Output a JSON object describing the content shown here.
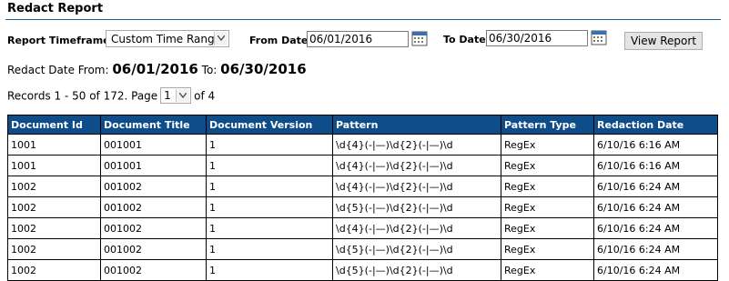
{
  "page": {
    "title": "Redact Report"
  },
  "filters": {
    "timeframe_label": "Report Timeframe",
    "timeframe_value": "Custom Time Range",
    "from_label": "From Date",
    "from_value": "06/01/2016",
    "to_label": "To Date",
    "to_value": "06/30/2016",
    "view_button": "View Report"
  },
  "summary": {
    "prefix": "Redact Date From:",
    "from": "06/01/2016",
    "to_label": "To:",
    "to": "06/30/2016"
  },
  "pager": {
    "records_text": "Records 1 - 50 of 172. Page",
    "page_value": "1",
    "of_text": "of 4"
  },
  "table": {
    "headers": [
      "Document Id",
      "Document Title",
      "Document Version",
      "Pattern",
      "Pattern Type",
      "Redaction Date"
    ],
    "rows": [
      [
        "1001",
        "001001",
        "1",
        "\\d{4}(-|—)\\d{2}(-|—)\\d",
        "RegEx",
        "6/10/16 6:16 AM"
      ],
      [
        "1001",
        "001001",
        "1",
        "\\d{4}(-|—)\\d{2}(-|—)\\d",
        "RegEx",
        "6/10/16 6:16 AM"
      ],
      [
        "1002",
        "001002",
        "1",
        "\\d{4}(-|—)\\d{2}(-|—)\\d",
        "RegEx",
        "6/10/16 6:24 AM"
      ],
      [
        "1002",
        "001002",
        "1",
        "\\d{5}(-|—)\\d{2}(-|—)\\d",
        "RegEx",
        "6/10/16 6:24 AM"
      ],
      [
        "1002",
        "001002",
        "1",
        "\\d{4}(-|—)\\d{2}(-|—)\\d",
        "RegEx",
        "6/10/16 6:24 AM"
      ],
      [
        "1002",
        "001002",
        "1",
        "\\d{5}(-|—)\\d{2}(-|—)\\d",
        "RegEx",
        "6/10/16 6:24 AM"
      ],
      [
        "1002",
        "001002",
        "1",
        "\\d{5}(-|—)\\d{2}(-|—)\\d",
        "RegEx",
        "6/10/16 6:24 AM"
      ]
    ]
  },
  "icons": {
    "calendar": "calendar-icon",
    "dropdown": "chevron-down-icon"
  },
  "colors": {
    "header_bg": "#0f4d8a",
    "title_rule": "#1f5e8f"
  }
}
